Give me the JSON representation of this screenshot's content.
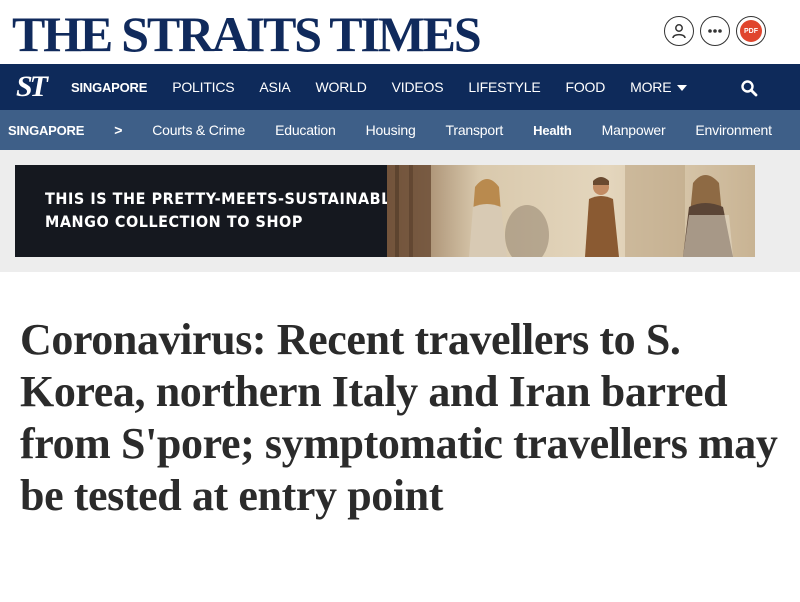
{
  "masthead": {
    "title": "THE STRAITS TIMES",
    "icons": [
      "user-icon",
      "more-icon",
      "pdf-icon"
    ],
    "pdf_label": "PDF"
  },
  "nav": {
    "logo": "ST",
    "items": [
      "SINGAPORE",
      "POLITICS",
      "ASIA",
      "WORLD",
      "VIDEOS",
      "LIFESTYLE",
      "FOOD",
      "MORE"
    ],
    "active": "SINGAPORE"
  },
  "subnav": {
    "section": "SINGAPORE",
    "separator": ">",
    "items": [
      "Courts & Crime",
      "Education",
      "Housing",
      "Transport",
      "Health",
      "Manpower",
      "Environment"
    ],
    "active": "Health"
  },
  "ad": {
    "line1": "THIS IS THE PRETTY-MEETS-SUSTAINABLE",
    "line2": "MANGO COLLECTION TO SHOP"
  },
  "article": {
    "headline": "Coronavirus: Recent travellers to S. Korea, northern Italy and Iran barred from S'pore; symptomatic travellers may be tested at entry point"
  },
  "colors": {
    "brand_navy": "#0e2a5a",
    "subnav_blue": "#3e5f88",
    "headline_text": "#2b2b2b",
    "pdf_red": "#e0452d"
  }
}
